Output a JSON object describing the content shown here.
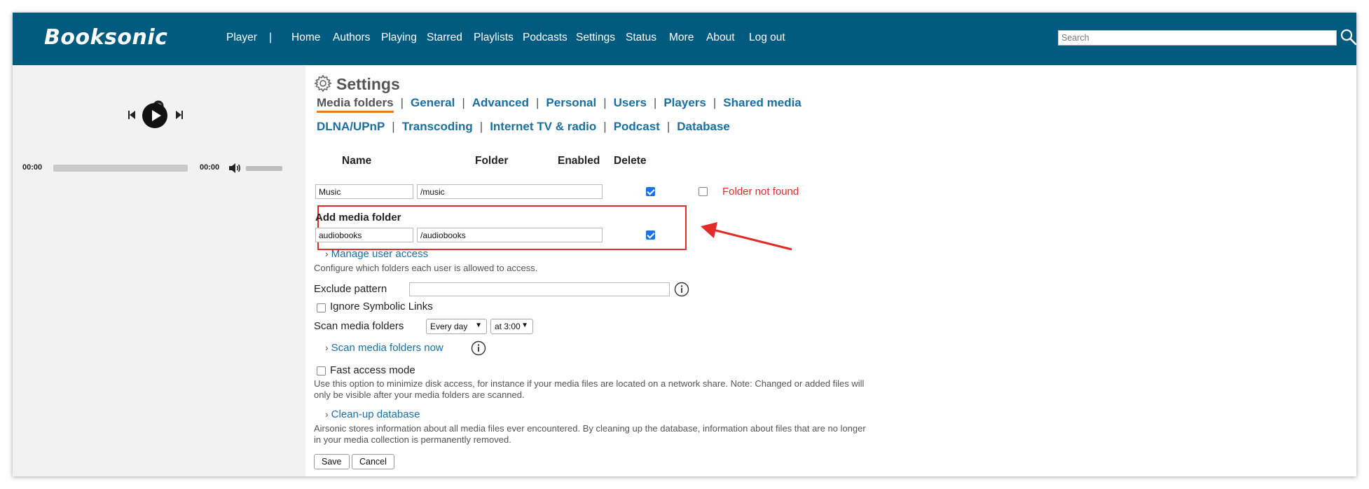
{
  "app": {
    "name": "Booksonic"
  },
  "nav": {
    "items": [
      "Player",
      "|",
      "Home",
      "Authors",
      "Playing",
      "Starred",
      "Playlists",
      "Podcasts",
      "Settings",
      "Status",
      "More",
      "About",
      "Log out"
    ]
  },
  "search": {
    "placeholder": "Search"
  },
  "player": {
    "time_elapsed": "00:00",
    "time_total": "00:00",
    "progress": 0
  },
  "settings": {
    "title": "Settings",
    "tabs_row1": [
      "Media folders",
      "General",
      "Advanced",
      "Personal",
      "Users",
      "Players",
      "Shared media"
    ],
    "tabs_row2": [
      "DLNA/UPnP",
      "Transcoding",
      "Internet TV & radio",
      "Podcast",
      "Database"
    ],
    "active_tab": "Media folders",
    "table": {
      "headers": {
        "name": "Name",
        "folder": "Folder",
        "enabled": "Enabled",
        "delete": "Delete"
      },
      "rows": [
        {
          "name": "Music",
          "folder": "/music",
          "enabled": true,
          "delete": false,
          "status": "Folder not found"
        }
      ]
    },
    "add_folder": {
      "title": "Add media folder",
      "name": "audiobooks",
      "folder": "/audiobooks",
      "enabled": true
    },
    "manage_user_access": {
      "link": "Manage user access",
      "desc": "Configure which folders each user is allowed to access."
    },
    "exclude_pattern": {
      "label": "Exclude pattern",
      "value": ""
    },
    "ignore_symlinks": {
      "label": "Ignore Symbolic Links",
      "checked": false
    },
    "scan": {
      "label": "Scan media folders",
      "frequency": "Every day",
      "time": "at 3:00",
      "now_link": "Scan media folders now"
    },
    "fast_access": {
      "label": "Fast access mode",
      "checked": false,
      "desc_line1": "Use this option to minimize disk access, for instance if your media files are located on a network share. Note: Changed or added files will",
      "desc_line2": "only be visible after your media folders are scanned."
    },
    "cleanup": {
      "link": "Clean-up database",
      "desc_line1": "Airsonic stores information about all media files ever encountered. By cleaning up the database, information about files that are no longer",
      "desc_line2": "in your media collection is permanently removed."
    },
    "buttons": {
      "save": "Save",
      "cancel": "Cancel"
    }
  },
  "colors": {
    "header": "#005b7f",
    "link": "#1a6fa0",
    "active_tab_underline": "#e67e22",
    "error": "#e32b2b",
    "annotation": "#e32b2b"
  }
}
